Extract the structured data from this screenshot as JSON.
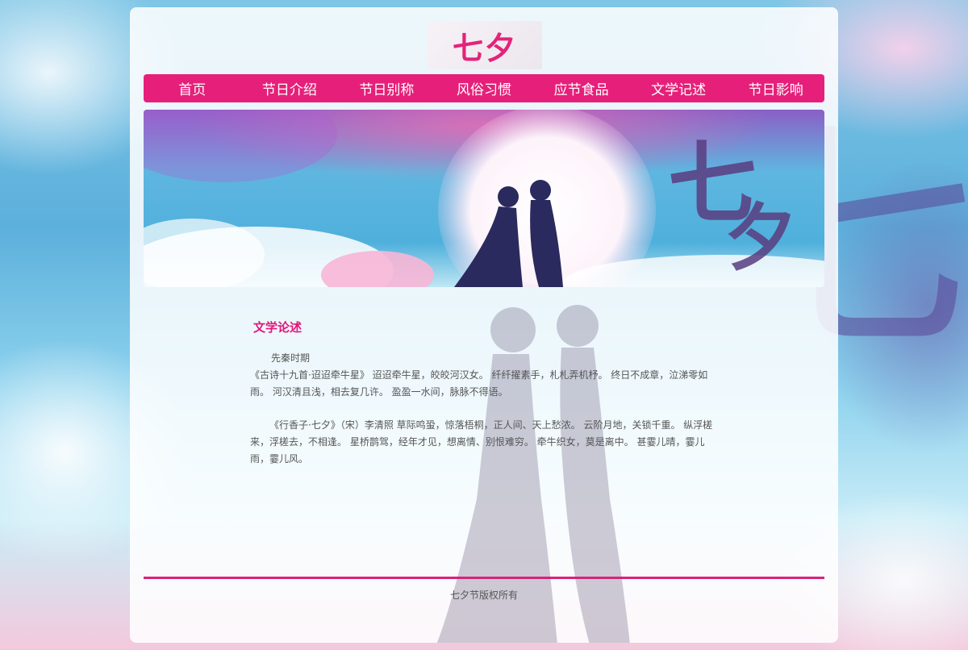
{
  "logo": {
    "text": "七夕"
  },
  "nav": {
    "items": [
      {
        "label": "首页"
      },
      {
        "label": "节日介绍"
      },
      {
        "label": "节日别称"
      },
      {
        "label": "风俗习惯"
      },
      {
        "label": "应节食品"
      },
      {
        "label": "文学记述"
      },
      {
        "label": "节日影响"
      }
    ]
  },
  "banner": {
    "text": "七夕"
  },
  "content": {
    "heading": "文学论述",
    "period": "先秦时期",
    "poem1": "《古诗十九首·迢迢牵牛星》 迢迢牵牛星，皎皎河汉女。 纤纤擢素手，札札弄机杼。 终日不成章，泣涕零如雨。 河汉清且浅，相去复几许。 盈盈一水间，脉脉不得语。",
    "poem2": "《行香子·七夕》（宋）李清照 草际鸣蛩，惊落梧桐，正人间、天上愁浓。 云阶月地，关锁千重。 纵浮槎来，浮槎去，不相逢。 星桥鹊驾，经年才见，想离情、别恨难穷。 牵牛织女，莫是离中。 甚霎儿晴，霎儿雨，霎儿风。"
  },
  "footer": {
    "text": "七夕节版权所有"
  },
  "colors": {
    "accent": "#e6207a",
    "heading": "#e3147a",
    "text": "#555555"
  },
  "icons": [
    "qixi-logo",
    "couple-silhouette"
  ]
}
